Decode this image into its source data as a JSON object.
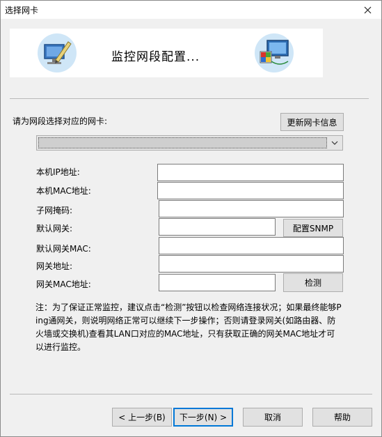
{
  "window": {
    "title": "选择网卡"
  },
  "banner": {
    "title": "监控网段配置..."
  },
  "nic": {
    "prompt": "请为网段选择对应的网卡:",
    "refresh_button": "更新网卡信息",
    "selected": ""
  },
  "fields": {
    "local_ip": {
      "label": "本机IP地址:",
      "value": ""
    },
    "local_mac": {
      "label": "本机MAC地址:",
      "value": ""
    },
    "subnet_mask": {
      "label": "子网掩码:",
      "value": ""
    },
    "default_gateway": {
      "label": "默认网关:",
      "value": ""
    },
    "gateway_mac_default": {
      "label": "默认网关MAC:",
      "value": ""
    },
    "gateway_address": {
      "label": "网关地址:",
      "value": ""
    },
    "gateway_mac": {
      "label": "网关MAC地址:",
      "value": ""
    }
  },
  "buttons": {
    "snmp": "配置SNMP",
    "detect": "检测",
    "back": "< 上一步(B)",
    "next": "下一步(N) >",
    "cancel": "取消",
    "help": "帮助"
  },
  "note": "注：为了保证正常监控，建议点击“检测”按钮以检查网络连接状况；如果最终能够Ping通网关，则说明网络正常可以继续下一步操作；否则请登录网关(如路由器、防火墙或交换机)查看其LAN口对应的MAC地址，只有获取正确的网关MAC地址才可以进行监控。",
  "icons": {
    "left": "edit-pc-icon",
    "right": "network-monitor-icon",
    "close": "close-icon",
    "dropdown": "chevron-down-icon"
  }
}
